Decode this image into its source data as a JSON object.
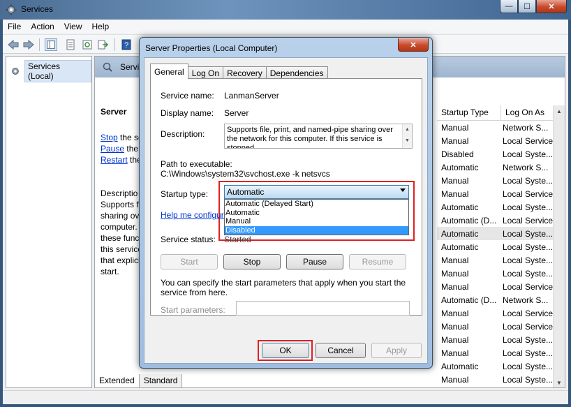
{
  "window": {
    "title": "Services",
    "controls": {
      "minimize": "—",
      "maximize": "☐",
      "close": "✕"
    }
  },
  "menu": [
    "File",
    "Action",
    "View",
    "Help"
  ],
  "tree": {
    "root": "Services (Local)"
  },
  "pane": {
    "header": "Servic",
    "selected_service": "Server",
    "links": [
      {
        "link": "Stop",
        "rest": " the se"
      },
      {
        "link": "Pause",
        "rest": " the s"
      },
      {
        "link": "Restart",
        "rest": " the"
      }
    ],
    "description_lines": [
      "Descriptio",
      "Supports fil",
      "sharing ove",
      "computer. I",
      "these functi",
      "this service",
      "that explicit",
      "start."
    ],
    "columns": {
      "startup_type": "Startup Type",
      "log_on_as": "Log On As"
    },
    "rows": [
      [
        "Manual",
        "Network S..."
      ],
      [
        "Manual",
        "Local Service"
      ],
      [
        "Disabled",
        "Local Syste..."
      ],
      [
        "Automatic",
        "Network S..."
      ],
      [
        "Manual",
        "Local Syste..."
      ],
      [
        "Manual",
        "Local Service"
      ],
      [
        "Automatic",
        "Local Syste..."
      ],
      [
        "Automatic (D...",
        "Local Service"
      ],
      [
        "Automatic",
        "Local Syste..."
      ],
      [
        "Automatic",
        "Local Syste..."
      ],
      [
        "Manual",
        "Local Syste..."
      ],
      [
        "Manual",
        "Local Syste..."
      ],
      [
        "Manual",
        "Local Service"
      ],
      [
        "Automatic (D...",
        "Network S..."
      ],
      [
        "Manual",
        "Local Service"
      ],
      [
        "Manual",
        "Local Service"
      ],
      [
        "Manual",
        "Local Syste..."
      ],
      [
        "Manual",
        "Local Syste..."
      ],
      [
        "Automatic",
        "Local Syste..."
      ],
      [
        "Manual",
        "Local Syste..."
      ]
    ],
    "selected_row_index": 8
  },
  "bottom_tabs": {
    "extended": "Extended",
    "standard": "Standard"
  },
  "dialog": {
    "title": "Server Properties (Local Computer)",
    "close": "✕",
    "tabs": [
      "General",
      "Log On",
      "Recovery",
      "Dependencies"
    ],
    "service_name_label": "Service name:",
    "service_name": "LanmanServer",
    "display_name_label": "Display name:",
    "display_name": "Server",
    "description_label": "Description:",
    "description": "Supports file, print, and named-pipe sharing over the network for this computer. If this service is stopped,",
    "path_label": "Path to executable:",
    "path": "C:\\Windows\\system32\\svchost.exe -k netsvcs",
    "startup_type_label": "Startup type:",
    "startup_type_value": "Automatic",
    "startup_options": [
      "Automatic (Delayed Start)",
      "Automatic",
      "Manual",
      "Disabled"
    ],
    "highlighted_option": "Disabled",
    "help_link": "Help me configure",
    "service_status_label": "Service status:",
    "service_status": "Started",
    "buttons": {
      "start": "Start",
      "stop": "Stop",
      "pause": "Pause",
      "resume": "Resume"
    },
    "hint": "You can specify the start parameters that apply when you start the service from here.",
    "start_params_label": "Start parameters:",
    "ok": "OK",
    "cancel": "Cancel",
    "apply": "Apply"
  },
  "colors": {
    "annotation_red": "#e02020",
    "link_blue": "#0033cc",
    "highlight_blue": "#3399ff"
  }
}
